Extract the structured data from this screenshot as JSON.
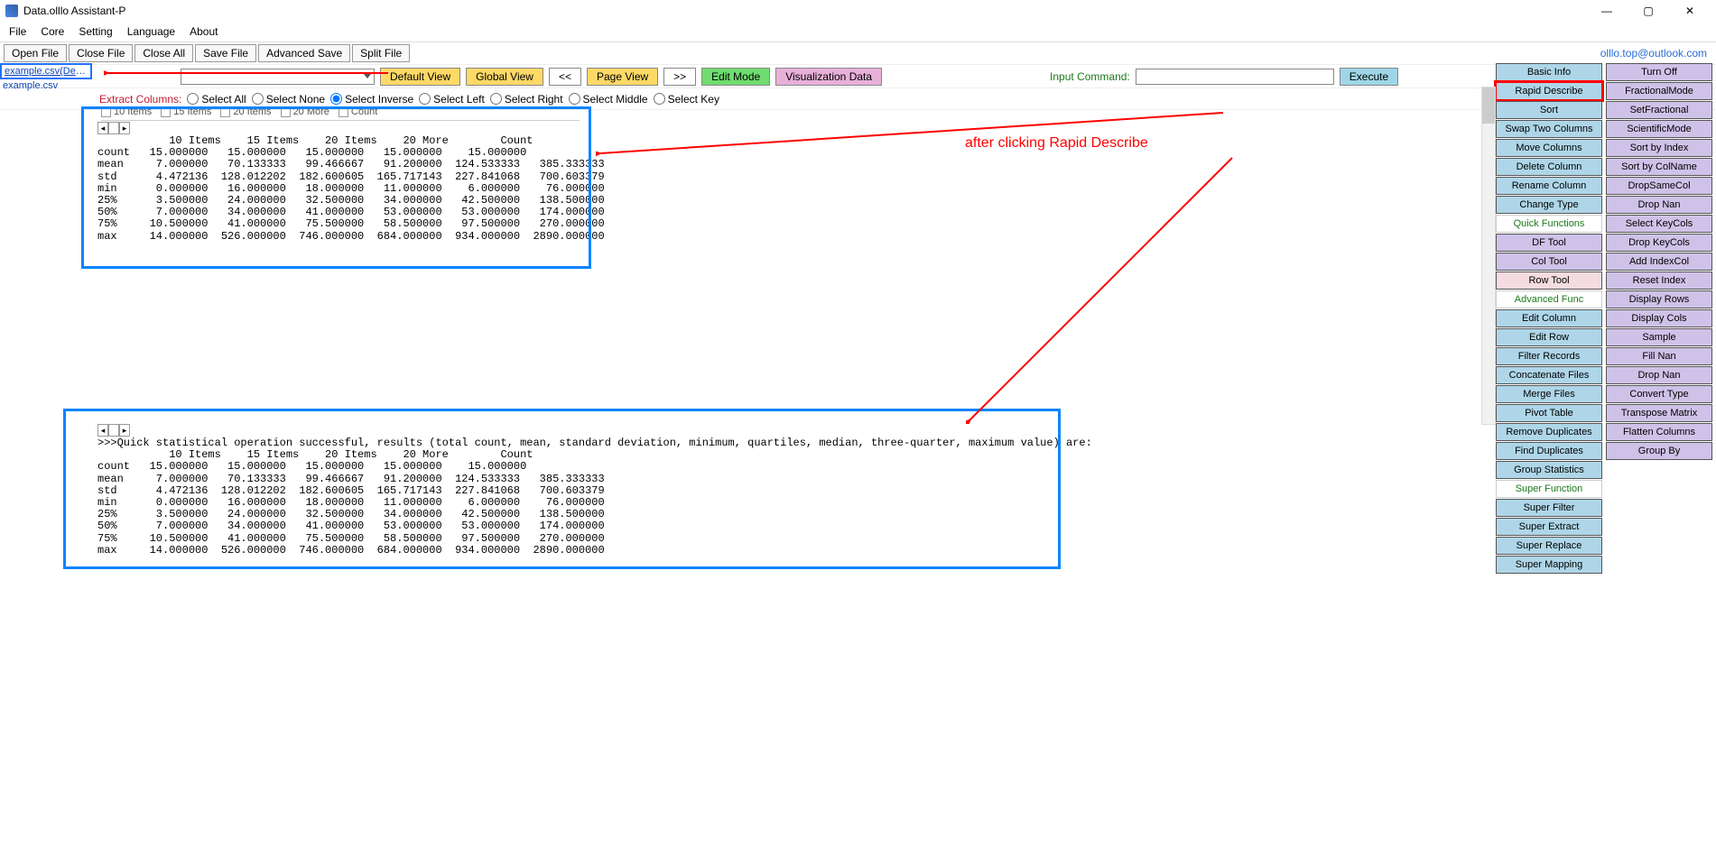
{
  "window": {
    "title": "Data.olllo Assistant-P"
  },
  "menu": {
    "items": [
      "File",
      "Core",
      "Setting",
      "Language",
      "About"
    ]
  },
  "toolbar1": {
    "buttons": [
      "Open File",
      "Close File",
      "Close All",
      "Save File",
      "Advanced Save",
      "Split File"
    ],
    "email": "olllo.top@outlook.com"
  },
  "toolbar2": {
    "default_view": "Default View",
    "global_view": "Global View",
    "page_prev": "<<",
    "page_view": "Page View",
    "page_next": ">>",
    "edit_mode": "Edit Mode",
    "viz": "Visualization Data",
    "cmd_label": "Input Command:",
    "execute": "Execute"
  },
  "extract": {
    "label": "Extract Columns:",
    "opts": [
      "Select All",
      "Select None",
      "Select Inverse",
      "Select Left",
      "Select Right",
      "Select Middle",
      "Select Key"
    ]
  },
  "checkcols": [
    "10 Items",
    "15 Items",
    "20 Items",
    "20 More",
    "Count"
  ],
  "tabs": {
    "active": "example.csv(Describe)",
    "inactive": "example.csv"
  },
  "right_left": [
    {
      "t": "Basic Info",
      "c": "cyan"
    },
    {
      "t": "Rapid Describe",
      "c": "hl"
    },
    {
      "t": "Sort",
      "c": "cyan"
    },
    {
      "t": "Swap Two Columns",
      "c": "cyan"
    },
    {
      "t": "Move Columns",
      "c": "cyan"
    },
    {
      "t": "Delete Column",
      "c": "cyan"
    },
    {
      "t": "Rename Column",
      "c": "cyan"
    },
    {
      "t": "Change Type",
      "c": "cyan"
    },
    {
      "t": "Quick Functions",
      "c": "wg"
    },
    {
      "t": "DF Tool",
      "c": "lav"
    },
    {
      "t": "Col Tool",
      "c": "lav"
    },
    {
      "t": "Row Tool",
      "c": "pink"
    },
    {
      "t": "Advanced Func",
      "c": "wg"
    },
    {
      "t": "Edit Column",
      "c": "cyan"
    },
    {
      "t": "Edit Row",
      "c": "cyan"
    },
    {
      "t": "Filter Records",
      "c": "cyan"
    },
    {
      "t": "Concatenate Files",
      "c": "cyan"
    },
    {
      "t": "Merge Files",
      "c": "cyan"
    },
    {
      "t": "Pivot Table",
      "c": "cyan"
    },
    {
      "t": "Remove Duplicates",
      "c": "cyan"
    },
    {
      "t": "Find Duplicates",
      "c": "cyan"
    },
    {
      "t": "Group Statistics",
      "c": "cyan"
    },
    {
      "t": "Super Function",
      "c": "wg"
    },
    {
      "t": "Super Filter",
      "c": "cyan"
    },
    {
      "t": "Super Extract",
      "c": "cyan"
    },
    {
      "t": "Super Replace",
      "c": "cyan"
    },
    {
      "t": "Super Mapping",
      "c": "cyan"
    }
  ],
  "right_right": [
    {
      "t": "Turn Off",
      "c": "lav"
    },
    {
      "t": "FractionalMode",
      "c": "lav"
    },
    {
      "t": "SetFractional",
      "c": "lav"
    },
    {
      "t": "ScientificMode",
      "c": "lav"
    },
    {
      "t": "Sort by Index",
      "c": "lav"
    },
    {
      "t": "Sort by ColName",
      "c": "lav"
    },
    {
      "t": "DropSameCol",
      "c": "lav"
    },
    {
      "t": "Drop Nan",
      "c": "lav"
    },
    {
      "t": "Select KeyCols",
      "c": "lav"
    },
    {
      "t": "Drop KeyCols",
      "c": "lav"
    },
    {
      "t": "Add IndexCol",
      "c": "lav"
    },
    {
      "t": "Reset Index",
      "c": "lav"
    },
    {
      "t": "Display Rows",
      "c": "lav"
    },
    {
      "t": "Display Cols",
      "c": "lav"
    },
    {
      "t": "Sample",
      "c": "lav"
    },
    {
      "t": "Fill Nan",
      "c": "lav"
    },
    {
      "t": "Drop Nan",
      "c": "lav"
    },
    {
      "t": "Convert Type",
      "c": "lav"
    },
    {
      "t": "Transpose Matrix",
      "c": "lav"
    },
    {
      "t": "Flatten Columns",
      "c": "lav"
    },
    {
      "t": "Group By",
      "c": "lav"
    }
  ],
  "annot": "after clicking Rapid Describe",
  "block_top": "           10 Items    15 Items    20 Items    20 More        Count\ncount   15.000000   15.000000   15.000000   15.000000    15.000000\nmean     7.000000   70.133333   99.466667   91.200000  124.533333   385.333333\nstd      4.472136  128.012202  182.600605  165.717143  227.841068   700.603379\nmin      0.000000   16.000000   18.000000   11.000000    6.000000    76.000000\n25%      3.500000   24.000000   32.500000   34.000000   42.500000   138.500000\n50%      7.000000   34.000000   41.000000   53.000000   53.000000   174.000000\n75%     10.500000   41.000000   75.500000   58.500000   97.500000   270.000000\nmax     14.000000  526.000000  746.000000  684.000000  934.000000  2890.000000",
  "block_bottom": ">>>Quick statistical operation successful, results (total count, mean, standard deviation, minimum, quartiles, median, three-quarter, maximum value) are:\n           10 Items    15 Items    20 Items    20 More        Count\ncount   15.000000   15.000000   15.000000   15.000000    15.000000\nmean     7.000000   70.133333   99.466667   91.200000  124.533333   385.333333\nstd      4.472136  128.012202  182.600605  165.717143  227.841068   700.603379\nmin      0.000000   16.000000   18.000000   11.000000    6.000000    76.000000\n25%      3.500000   24.000000   32.500000   34.000000   42.500000   138.500000\n50%      7.000000   34.000000   41.000000   53.000000   53.000000   174.000000\n75%     10.500000   41.000000   75.500000   58.500000   97.500000   270.000000\nmax     14.000000  526.000000  746.000000  684.000000  934.000000  2890.000000",
  "win_controls": {
    "min": "—",
    "max": "▢",
    "close": "✕"
  }
}
